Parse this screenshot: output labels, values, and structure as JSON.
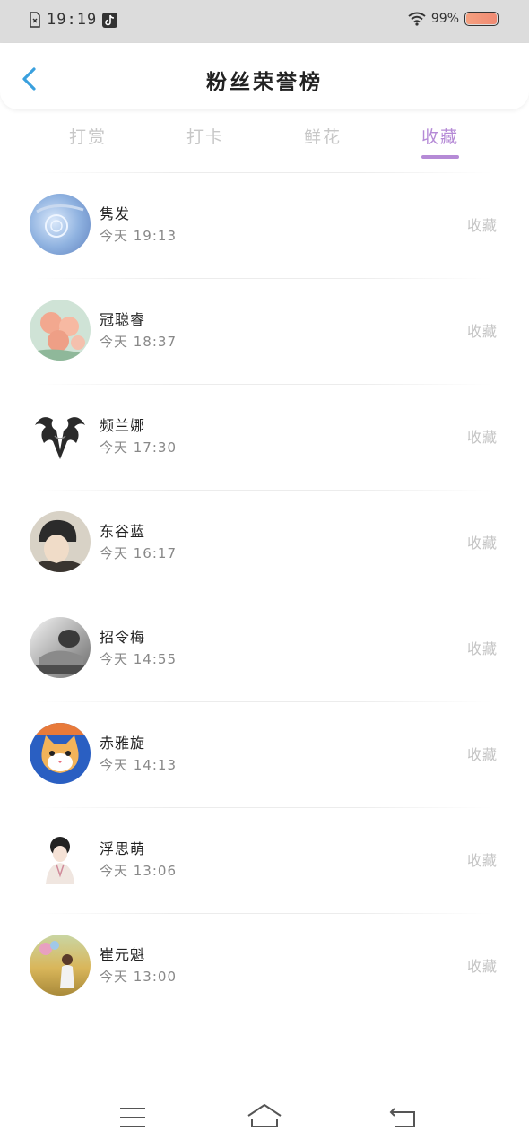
{
  "status": {
    "time": "19:19",
    "battery": "99%"
  },
  "header": {
    "title": "粉丝荣誉榜"
  },
  "tabs": [
    {
      "label": "打赏",
      "active": false
    },
    {
      "label": "打卡",
      "active": false
    },
    {
      "label": "鲜花",
      "active": false
    },
    {
      "label": "收藏",
      "active": true
    }
  ],
  "list": [
    {
      "name": "隽发",
      "time": "今天 19:13",
      "action": "收藏"
    },
    {
      "name": "冠聪睿",
      "time": "今天 18:37",
      "action": "收藏"
    },
    {
      "name": "频兰娜",
      "time": "今天 17:30",
      "action": "收藏"
    },
    {
      "name": "东谷蓝",
      "time": "今天 16:17",
      "action": "收藏"
    },
    {
      "name": "招令梅",
      "time": "今天 14:55",
      "action": "收藏"
    },
    {
      "name": "赤雅旋",
      "time": "今天 14:13",
      "action": "收藏"
    },
    {
      "name": "浮思萌",
      "time": "今天 13:06",
      "action": "收藏"
    },
    {
      "name": "崔元魁",
      "time": "今天 13:00",
      "action": "收藏"
    }
  ],
  "colors": {
    "accent": "#b58ad6",
    "back": "#3aa0de",
    "muted": "#c7c7c7"
  }
}
